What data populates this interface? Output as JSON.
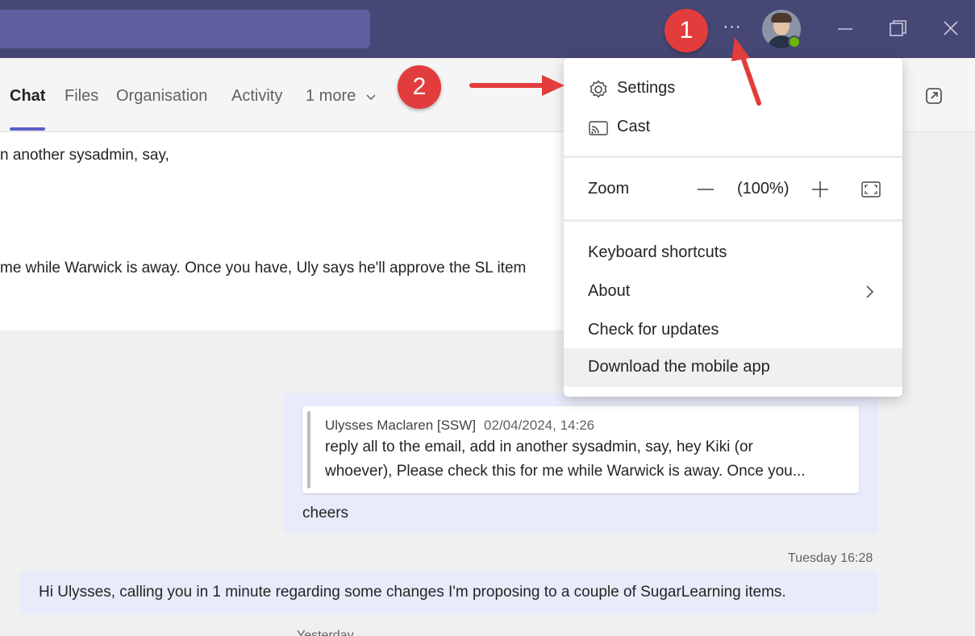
{
  "titlebar": {
    "more_label": "···",
    "icons": [
      "more-icon",
      "minimize-icon",
      "maximize-icon",
      "close-icon"
    ]
  },
  "tabs": [
    {
      "label": "Chat",
      "active": true
    },
    {
      "label": "Files"
    },
    {
      "label": "Organisation"
    },
    {
      "label": "Activity"
    },
    {
      "label": "1 more"
    }
  ],
  "chat": {
    "top_line_1": "n another sysadmin, say,",
    "top_line_2": "me while Warwick is away. Once you have, Uly says he'll approve the SL item",
    "quote_author": "Ulysses Maclaren [SSW]",
    "quote_timestamp": "02/04/2024, 14:26",
    "quote_line_1": "reply all to the email, add in another sysadmin, say, hey Kiki (or",
    "quote_line_2": "whoever), Please check this for me while Warwick is away. Once you...",
    "reply": "cheers",
    "timestamp": "Tuesday 16:28",
    "message": "Hi Ulysses, calling you in 1 minute regarding some changes I'm proposing to a couple of SugarLearning items.",
    "day_label": "Yesterday"
  },
  "menu": {
    "settings": "Settings",
    "cast": "Cast",
    "zoom_label": "Zoom",
    "zoom_value": "(100%)",
    "keyboard_shortcuts": "Keyboard shortcuts",
    "about": "About",
    "check_updates": "Check for updates",
    "download_app": "Download the mobile app"
  },
  "annotations": {
    "badge_1": "1",
    "badge_2": "2",
    "color": "#e23c3c"
  },
  "colors": {
    "titlebar": "#464775",
    "accent": "#5b5fc7",
    "bubble": "#e8ebfa"
  }
}
